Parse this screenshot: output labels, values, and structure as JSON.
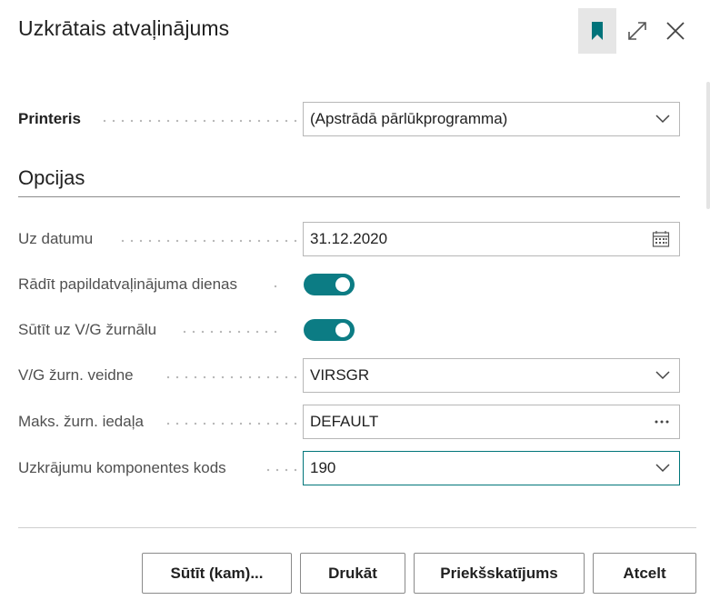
{
  "dialog": {
    "title": "Uzkrātais atvaļinājums"
  },
  "printer": {
    "label": "Printeris",
    "value": "(Apstrādā pārlūkprogramma)"
  },
  "options": {
    "heading": "Opcijas",
    "fields": [
      {
        "label": "Uz datumu",
        "value": "31.12.2020",
        "icon": "calendar-icon"
      },
      {
        "label": "Rādīt papildatvaļinājuma dienas",
        "toggle": true
      },
      {
        "label": "Sūtīt uz V/G žurnālu",
        "toggle": true
      },
      {
        "label": "V/G žurn. veidne",
        "value": "VIRSGR",
        "icon": "chevron-down-icon"
      },
      {
        "label": "Maks. žurn. iedaļa",
        "value": "DEFAULT",
        "icon": "ellipsis-icon"
      },
      {
        "label": "Uzkrājumu komponentes kods",
        "value": "190",
        "icon": "chevron-down-icon"
      }
    ]
  },
  "buttons": {
    "send": "Sūtīt (kam)...",
    "print": "Drukāt",
    "preview": "Priekšskatījums",
    "cancel": "Atcelt"
  },
  "colors": {
    "accent": "#0c7c84",
    "focus_border": "#00757a"
  }
}
